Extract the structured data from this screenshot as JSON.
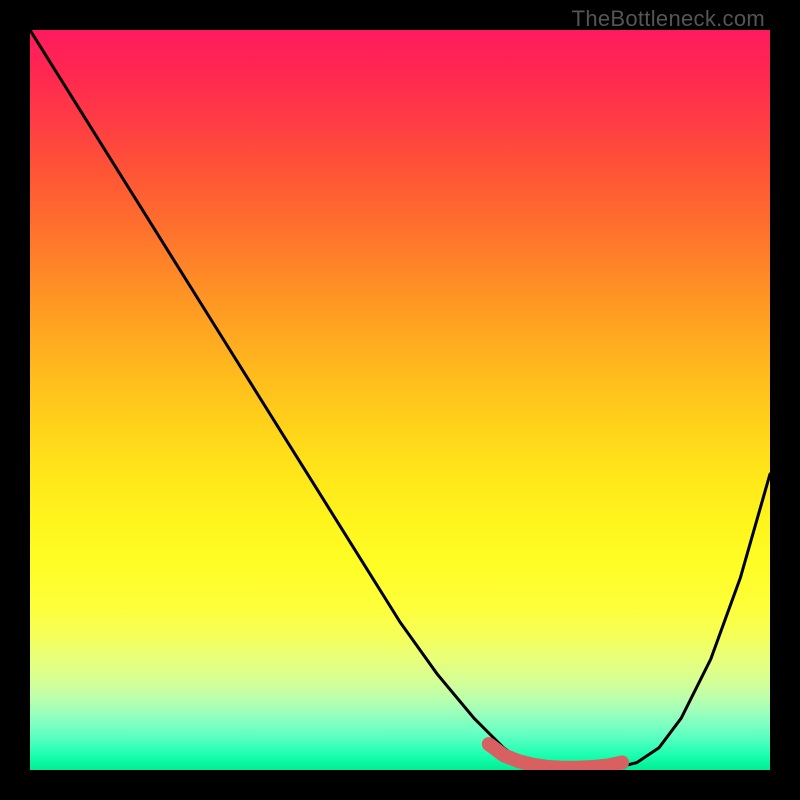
{
  "watermark": "TheBottleneck.com",
  "chart_data": {
    "type": "line",
    "title": "",
    "xlabel": "",
    "ylabel": "",
    "xlim": [
      0,
      100
    ],
    "ylim": [
      0,
      100
    ],
    "series": [
      {
        "name": "bottleneck-curve",
        "color": "#000000",
        "x": [
          0,
          5,
          10,
          15,
          20,
          25,
          30,
          35,
          40,
          45,
          50,
          55,
          60,
          62,
          64,
          66,
          68,
          70,
          72,
          74,
          76,
          78,
          80,
          82,
          85,
          88,
          92,
          96,
          100
        ],
        "y": [
          100,
          92,
          84,
          76,
          68,
          60,
          52,
          44,
          36,
          28,
          20,
          13,
          7,
          5,
          3,
          1.5,
          0.8,
          0.4,
          0.2,
          0.1,
          0.1,
          0.2,
          0.5,
          1,
          3,
          7,
          15,
          26,
          40
        ]
      },
      {
        "name": "optimal-zone",
        "color": "#d96060",
        "x": [
          62,
          64,
          66,
          68,
          70,
          72,
          74,
          76,
          78,
          80
        ],
        "y": [
          3.5,
          2,
          1.2,
          0.7,
          0.4,
          0.3,
          0.3,
          0.4,
          0.6,
          1.0
        ]
      }
    ],
    "background_gradient": {
      "top": "#ff1a5e",
      "middle": "#ffd400",
      "bottom": "#00ee95"
    },
    "grid": false,
    "legend": false
  }
}
